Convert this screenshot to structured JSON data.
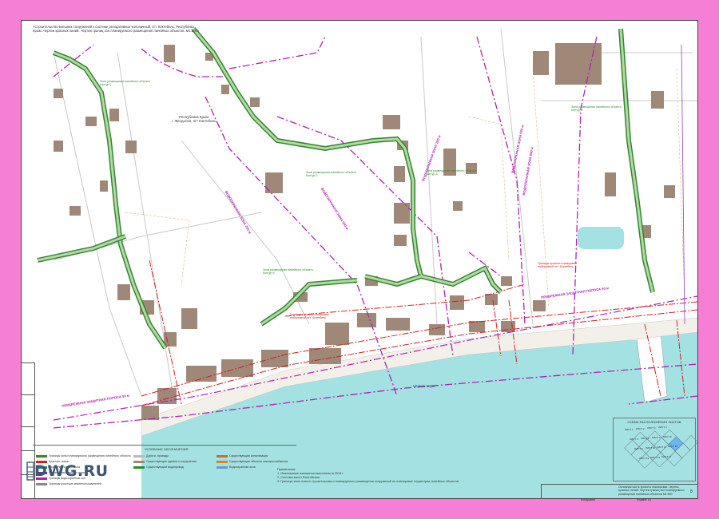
{
  "title_note": "«Строительство внешних сооружений к системе регидативных колоночный, пгт. Коктебель, Республика Крым. Чертеж красных линий. Чертеж границ зон планируемого размещения линейных объектов. М1:500»",
  "labels": {
    "settlement": "Республика Крым\nг. Феодосия, пгт Коктебель",
    "sea": "Черное море",
    "zone_coastal_left": "ПРИБРЕЖНАЯ ЗАЩИТНАЯ ПОЛОСА 50 м",
    "zone_coastal_right": "ПРИБРЕЖНАЯ ЗАЩИТНАЯ ПОЛОСА 50 м",
    "zone_water_1": "ВОДООХРАННАЯ ЗОНА 200 м",
    "zone_water_2": "ВОДООХРАННАЯ ЗОНА 500 м",
    "zone_water_3": "ВОДООХРАННАЯ ЗОНА 200 м",
    "zone_water_4": "ВОДООХРАННАЯ ЗОНА 500 м",
    "zone_water_5": "ВОДООХРАННАЯ ЗОНА 500 м",
    "placement_1": "Зона размещения линейного объекта\nКонтур 1",
    "placement_2": "Зона размещения линейного объекта\nКонтур 2",
    "placement_3": "Зона размещения линейного объекта\nКонтур 3",
    "placement_4": "Зона размещения линейного объекта\nКонтур 4",
    "placement_5": "Зона размещения линейного объекта\nКонтур 5",
    "project_border_1": "Границы проекта планировки\nнабережной пгт. Коктебель",
    "project_border_2": "Границы проекта планировки\nнабережной пгт. Коктебель"
  },
  "legend": {
    "title": "УСЛОВНЫЕ ОБОЗНАЧЕНИЯ",
    "items": [
      {
        "label": "Границы зоны планируемого размещения линейного объекта",
        "color": "#2b8a2b"
      },
      {
        "label": "Красные линии",
        "color": "#d02020"
      },
      {
        "label": "Ось линейного объекта",
        "color": "#2b8a2b"
      },
      {
        "label": "Границы населенного пункта",
        "color": "#7030a0"
      },
      {
        "label": "Границы водоохранных зон",
        "color": "#b020b0"
      },
      {
        "label": "Границы участков землепользователей",
        "color": "#888888"
      },
      {
        "label": "Дороги, проезды",
        "color": "#bbbbbb"
      },
      {
        "label": "Существующие здания и сооружения",
        "color": "#a08878"
      },
      {
        "label": "Существующий водопровод",
        "color": "#2b8a2b"
      },
      {
        "label": "Существующая канализация",
        "color": "#c07030"
      },
      {
        "label": "Существующие объекты электроснабжения",
        "color": "#e08020"
      },
      {
        "label": "Водоохранная зона",
        "color": "#5a9fd8"
      }
    ]
  },
  "notes": {
    "title": "Примечания:",
    "lines": [
      "1. Инженерные изыскания выполнены в 2018 г.",
      "2. Система высот Балтийская.",
      "3. Границы зоны нового строительства и планируемого размещения сооружений по планировке территории линейных объектов."
    ]
  },
  "scheme": {
    "title": "СХЕМА РАСПОЛОЖЕНИЯ ЛИСТОВ",
    "sheets": [
      "ЛИСТ 1",
      "ЛИСТ 2",
      "ЛИСТ 3",
      "ЛИСТ 4",
      "ЛИСТ 5",
      "ЛИСТ 6",
      "ЛИСТ 7",
      "ЛИСТ 8",
      "ЛИСТ 9",
      "ЛИСТ 10",
      "ЛИСТ 11",
      "ЛИСТ 12",
      "ЛИСТ 13",
      "ЛИСТ 14",
      "ЛИСТ 15"
    ]
  },
  "stamp": {
    "description": "Основная часть проекта планировки. Чертеж красных линий. Чертеж границ зон планируемого размещения линейных объектов М1:500",
    "sheet_no": "8",
    "format": "Формат А1",
    "copied": "Копировал"
  },
  "logo": "DWG.RU",
  "colors": {
    "background": "#f57fd4",
    "sea": "#a4e1e3",
    "building": "#a08878",
    "zone_green": "#2b8a2b",
    "red_line": "#d02020",
    "purple_zone": "#b020b0"
  }
}
